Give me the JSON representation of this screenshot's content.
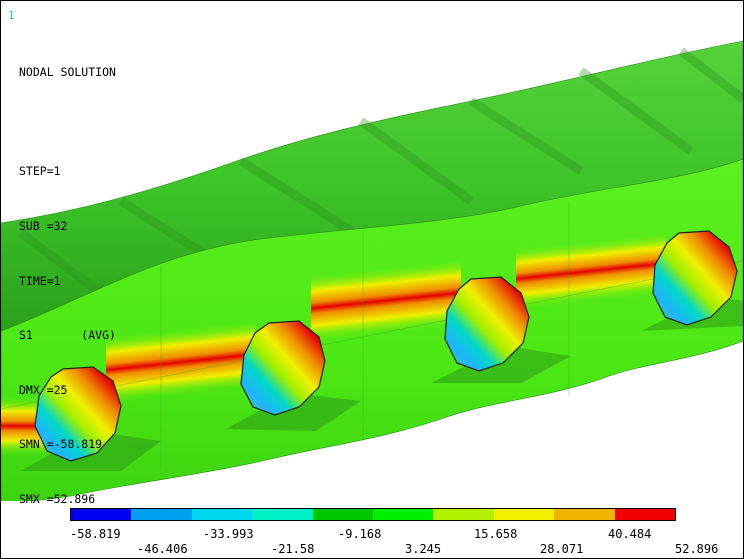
{
  "window_number": "1",
  "info": {
    "title": "NODAL SOLUTION",
    "lines": [
      "STEP=1",
      "SUB =32",
      "TIME=1",
      "S1       (AVG)",
      "DMX =25",
      "SMN =-58.819",
      "SMX =52.896"
    ]
  },
  "legend": {
    "colors": [
      "#0000f0",
      "#00a0f0",
      "#00d8f0",
      "#00f0c8",
      "#00c800",
      "#00f000",
      "#b0f000",
      "#f0f000",
      "#f0b400",
      "#f00000"
    ],
    "top_labels": [
      "-58.819",
      "-33.993",
      "-9.168",
      "15.658",
      "40.484"
    ],
    "bottom_labels": [
      "-46.406",
      "-21.58",
      "3.245",
      "28.071",
      "52.896"
    ]
  },
  "model": {
    "background": "#ffffff",
    "lower_band_color": "#4ce814",
    "upper_band_color": "#3cc428",
    "high_stress_color": "#e40000",
    "low_stress_color": "#22b4ff",
    "shadow_color": "#2e9a18",
    "hole_count": 4
  }
}
